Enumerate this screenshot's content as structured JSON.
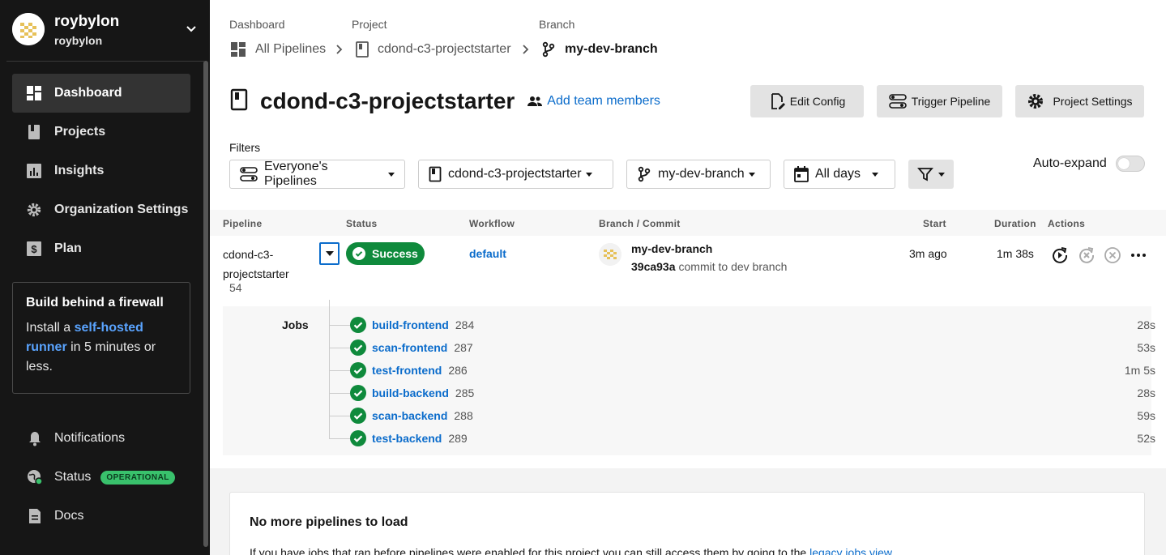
{
  "org": {
    "name": "roybylon",
    "sub": "roybylon"
  },
  "sidebar": {
    "items": [
      {
        "label": "Dashboard",
        "icon": "dashboard-icon",
        "active": true
      },
      {
        "label": "Projects",
        "icon": "book-icon"
      },
      {
        "label": "Insights",
        "icon": "chart-icon"
      },
      {
        "label": "Organization Settings",
        "icon": "gear-icon"
      },
      {
        "label": "Plan",
        "icon": "dollar-icon"
      }
    ],
    "promo": {
      "title": "Build behind a firewall",
      "text_before": "Install a ",
      "link": "self-hosted runner",
      "text_after": " in 5 minutes or less."
    },
    "secondary": [
      {
        "label": "Notifications",
        "icon": "bell-icon"
      },
      {
        "label": "Status",
        "icon": "status-globe-icon",
        "badge": "OPERATIONAL"
      },
      {
        "label": "Docs",
        "icon": "doc-icon"
      }
    ]
  },
  "breadcrumb": {
    "labels": [
      "Dashboard",
      "Project",
      "Branch"
    ],
    "items": [
      "All Pipelines",
      "cdond-c3-projectstarter",
      "my-dev-branch"
    ]
  },
  "project": {
    "title": "cdond-c3-projectstarter",
    "add_team": "Add team members"
  },
  "actions": {
    "edit_config": "Edit Config",
    "trigger": "Trigger Pipeline",
    "settings": "Project Settings"
  },
  "filters": {
    "label": "Filters",
    "pipelines": "Everyone's Pipelines",
    "project": "cdond-c3-projectstarter",
    "branch": "my-dev-branch",
    "days": "All days",
    "auto_expand": "Auto-expand",
    "auto_expand_on": false
  },
  "table": {
    "headers": [
      "Pipeline",
      "Status",
      "Workflow",
      "Branch / Commit",
      "Start",
      "Duration",
      "Actions"
    ],
    "row": {
      "pipeline": "cdond-c3-projectstarter",
      "number": "54",
      "status": "Success",
      "workflow": "default",
      "branch": "my-dev-branch",
      "sha": "39ca93a",
      "message": "commit to dev branch",
      "start": "3m ago",
      "duration": "1m 38s"
    },
    "jobs_label": "Jobs",
    "jobs": [
      {
        "name": "build-frontend",
        "num": "284",
        "duration": "28s"
      },
      {
        "name": "scan-frontend",
        "num": "287",
        "duration": "53s"
      },
      {
        "name": "test-frontend",
        "num": "286",
        "duration": "1m 5s"
      },
      {
        "name": "build-backend",
        "num": "285",
        "duration": "28s"
      },
      {
        "name": "scan-backend",
        "num": "288",
        "duration": "59s"
      },
      {
        "name": "test-backend",
        "num": "289",
        "duration": "52s"
      }
    ]
  },
  "footer": {
    "title": "No more pipelines to load",
    "text_before": "If you have jobs that ran before pipelines were enabled for this project you can still access them by going to the ",
    "link": "legacy jobs view"
  },
  "colors": {
    "sidebar_bg": "#161616",
    "success": "#0f8a3c",
    "link": "#0b6ccb",
    "badge": "#39c16c"
  }
}
